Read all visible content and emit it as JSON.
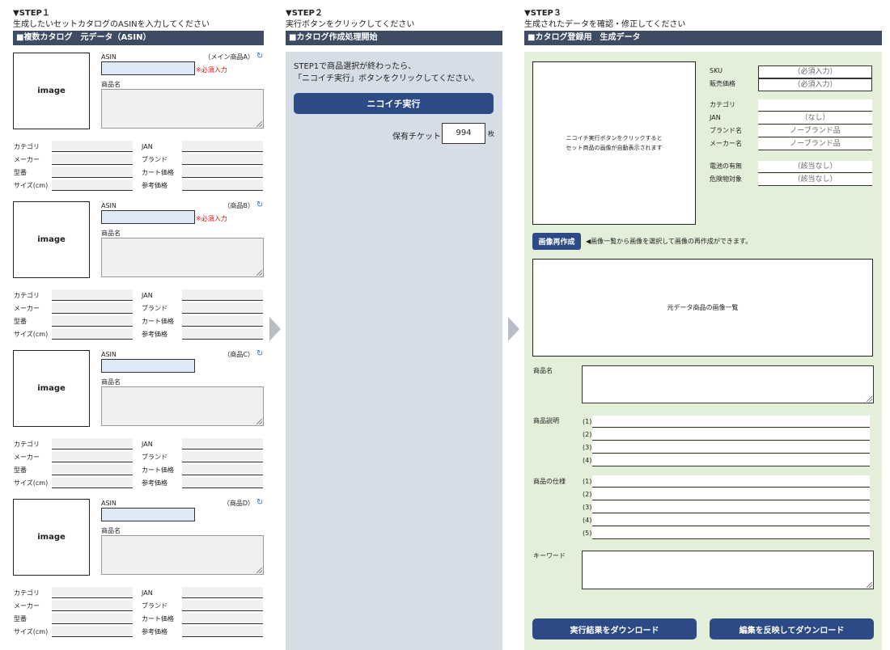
{
  "step1": {
    "title": "▼STEP１",
    "subtitle": "生成したいセットカタログのASINを入力してください",
    "bar": "■複数カタログ　元データ（ASIN）",
    "asin_label": "ASIN",
    "required_label": "※必須入力",
    "product_name_label": "商品名",
    "image_label": "image",
    "refresh_glyph": "↻",
    "field_labels_left": [
      "カテゴリ",
      "メーカー",
      "型番",
      "サイズ(cm)"
    ],
    "field_labels_right": [
      "JAN",
      "ブランド",
      "カート価格",
      "参考価格"
    ],
    "products": [
      {
        "tag": "（メイン商品A）"
      },
      {
        "tag": "（商品B）"
      },
      {
        "tag": "（商品C）"
      },
      {
        "tag": "（商品D）"
      }
    ]
  },
  "step2": {
    "title": "▼STEP２",
    "subtitle": "実行ボタンをクリックしてください",
    "bar": "■カタログ作成処理開始",
    "instruction_line1": "STEP1で商品選択が終わったら、",
    "instruction_line2": "「ニコイチ実行」ボタンをクリックしてください。",
    "run_button": "ニコイチ実行",
    "ticket_label": "保有チケット",
    "ticket_value": "994",
    "ticket_unit": "枚"
  },
  "step3": {
    "title": "▼STEP３",
    "subtitle": "生成されたデータを確認・修正してください",
    "bar": "■カタログ登録用　生成データ",
    "image_msg_line1": "ニコイチ実行ボタンをクリックすると",
    "image_msg_line2": "セット商品の画像が自動表示されます",
    "sku_label": "SKU",
    "sku_value": "（必須入力）",
    "price_label": "販売価格",
    "price_value": "（必須入力）",
    "category_label": "カテゴリ",
    "jan_label": "JAN",
    "jan_value": "（なし）",
    "brand_label": "ブランド名",
    "brand_value": "ノーブランド品",
    "maker_label": "メーカー名",
    "maker_value": "ノーブランド品",
    "battery_label": "電池の有無",
    "battery_value": "（該当なし）",
    "hazard_label": "危険物対象",
    "hazard_value": "（該当なし）",
    "regen_button": "画像再作成",
    "regen_note": "◀画像一覧から画像を選択して画像の再作成ができます。",
    "source_images_label": "元データ商品の画像一覧",
    "product_name_label": "商品名",
    "description_label": "商品説明",
    "description_numbers": [
      "(1)",
      "(2)",
      "(3)",
      "(4)"
    ],
    "spec_label": "商品の仕様",
    "spec_numbers": [
      "(1)",
      "(2)",
      "(3)",
      "(4)",
      "(5)"
    ],
    "keyword_label": "キーワード",
    "download_button": "実行結果をダウンロード",
    "edit_download_button": "編集を反映してダウンロード"
  }
}
